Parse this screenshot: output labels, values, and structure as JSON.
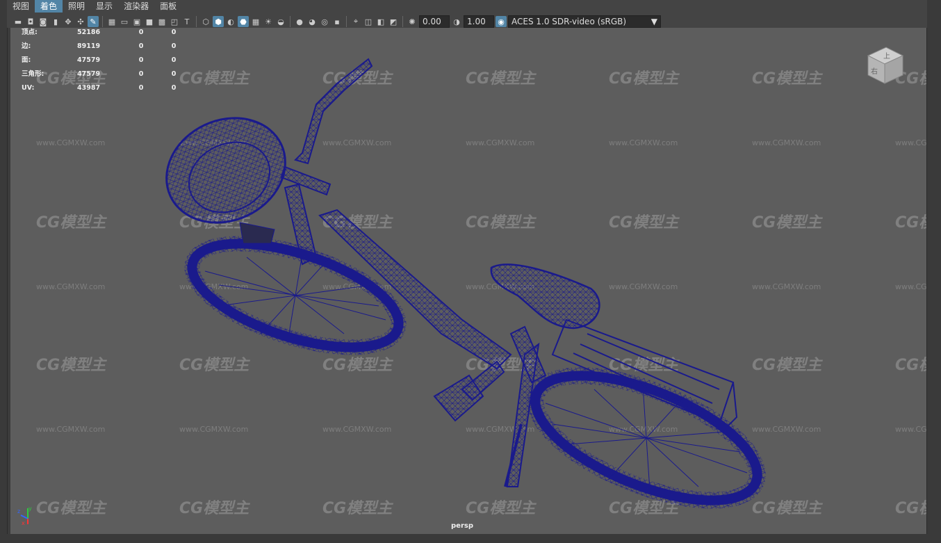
{
  "menu": [
    "视图",
    "着色",
    "照明",
    "显示",
    "渲染器",
    "面板"
  ],
  "menu_active_index": 1,
  "toolbar": {
    "exposure": "0.00",
    "gamma": "1.00",
    "colorspace": "ACES 1.0 SDR-video (sRGB)",
    "dropdown_arrow": "▼"
  },
  "stats": [
    {
      "label": "顶点:",
      "v1": "52186",
      "v2": "0",
      "v3": "0"
    },
    {
      "label": "边:",
      "v1": "89119",
      "v2": "0",
      "v3": "0"
    },
    {
      "label": "面:",
      "v1": "47579",
      "v2": "0",
      "v3": "0"
    },
    {
      "label": "三角形:",
      "v1": "47579",
      "v2": "0",
      "v3": "0"
    },
    {
      "label": "UV:",
      "v1": "43987",
      "v2": "0",
      "v3": "0"
    }
  ],
  "viewcube": {
    "top": "上",
    "front": "右"
  },
  "watermark": {
    "brand": "CG模型主",
    "url": "www.CGMXW.com"
  },
  "axis": {
    "x": "x",
    "y": "y",
    "z": "z"
  },
  "camera_label": "persp",
  "colors": {
    "wire": "#1a1a8c",
    "viewport": "#5d5d5d",
    "accent": "#5285a6"
  }
}
